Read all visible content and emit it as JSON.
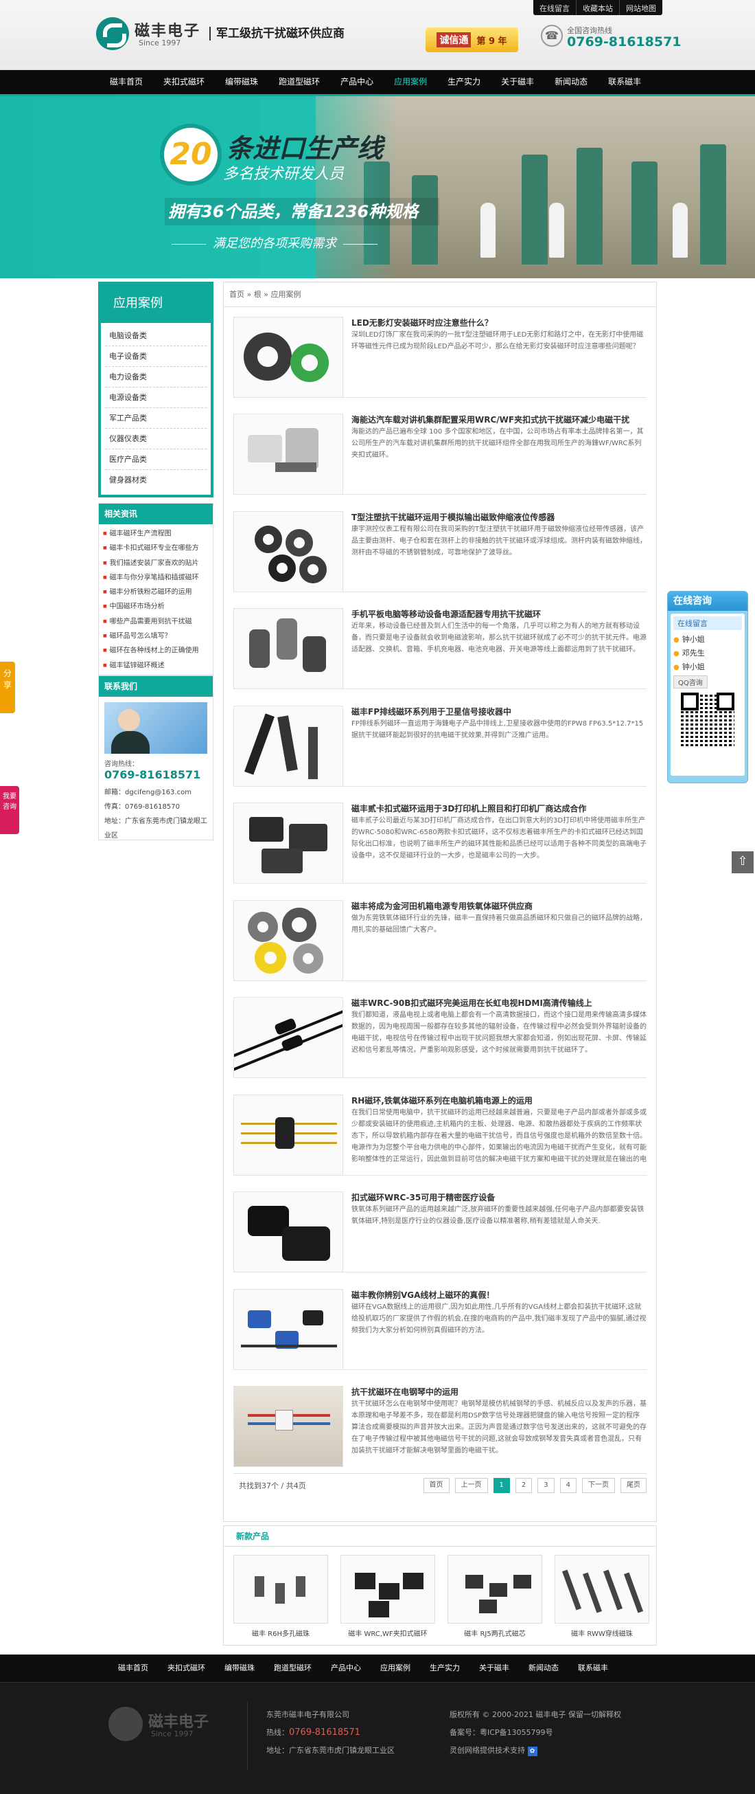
{
  "toplinks": [
    "在线留言",
    "收藏本站",
    "网站地图"
  ],
  "logo": {
    "name": "磁丰电子",
    "since": "Since 1997"
  },
  "slogan": "军工级抗干扰磁环供应商",
  "badge": {
    "tag": "诚信通",
    "years": "第 9 年"
  },
  "hotline": {
    "label": "全国咨询热线",
    "number": "0769-81618571"
  },
  "nav": [
    "磁丰首页",
    "夹扣式磁环",
    "编带磁珠",
    "跑道型磁环",
    "产品中心",
    "应用案例",
    "生产实力",
    "关于磁丰",
    "新闻动态",
    "联系磁丰"
  ],
  "banner": {
    "num": "20",
    "h1": "条进口生产线",
    "h2": "多名技术研发人员",
    "h3": "拥有36个品类，常备1236种规格",
    "h4": "满足您的各项采购需求"
  },
  "sidebar": {
    "title": "应用案例",
    "items": [
      "电脑设备类",
      "电子设备类",
      "电力设备类",
      "电源设备类",
      "军工产品类",
      "仪器仪表类",
      "医疗产品类",
      "健身器材类"
    ]
  },
  "related": {
    "title": "相关资讯",
    "items": [
      "磁丰磁环生产流程图",
      "磁丰卡扣式磁环专业在哪些方",
      "我们描述安装厂家喜欢的贴片",
      "磁丰与你分享笔插和插拔磁环",
      "磁丰分析铁粉芯磁环的运用",
      "中国磁环市场分析",
      "哪些产品需要用到抗干扰磁",
      "磁环品号怎么填写？",
      "磁环在各种线材上的正确使用",
      "磁丰锰锌磁环概述"
    ]
  },
  "contact": {
    "title": "联系我们",
    "hotline_label": "咨询热线：",
    "phone": "0769-81618571",
    "email": "邮箱：dgcifeng@163.com",
    "fax": "传真：0769-81618570",
    "address": "地址：广东省东莞市虎门镇龙眼工业区"
  },
  "breadcrumb": "首页 » 根 » 应用案例",
  "articles": [
    {
      "title": "LED无影灯安装磁环时应注意些什么？",
      "desc": "深圳LED灯饰厂家在我司采购的一批T型注塑磁环用于LED无影灯和路灯之中，在无影灯中使用磁环等磁性元件已成为现阶段LED产品必不可少，那么在给无影灯安装磁环时应注意哪些问题呢？"
    },
    {
      "title": "海能达汽车载对讲机集群配置采用WRC/WF夹扣式抗干扰磁环减少电磁干扰",
      "desc": "海能达的产品已遍布全球 100 多个国家和地区，在中国，公司市场占有率本土品牌排名第一，其公司所生产的汽车载对讲机集群所用的抗干扰磁环组件全部在用我司所生产的海鋒WF/WRC系列夹扣式磁环。"
    },
    {
      "title": "T型注塑抗干扰磁环运用于模拟输出磁致伸缩液位传感器",
      "desc": "康宇测控仪表工程有限公司在我司采购的T型注塑抗干扰磁环用于磁致伸缩液位经带传感器，该产品主要由测杆、电子仓和套在测杆上的非接触的抗干扰磁环或浮球组成。测杆内装有磁致伸缩线，测杆由不导磁的不锈钢管制成，可靠地保护了波导丝。"
    },
    {
      "title": "手机平板电脑等移动设备电源适配器专用抗干扰磁环",
      "desc": "近年来，移动设备已经普及到人们生活中的每一个角落，几乎可以称之为有人的地方就有移动设备，而只要是电子设备就会收到电磁波影响，那么抗干扰磁环就成了必不可少的抗干扰元件。电源适配器、交换机、音箱、手机充电器、电池充电器、开关电源等线上面都运用到了抗干扰磁环。"
    },
    {
      "title": "磁丰FP排线磁环系列用于卫星信号接收器中",
      "desc": "FP排线系列磁环一直运用于海鋒电子产品中排线上,卫星接收器中使用的FPW8 FP63.5*12.7*15据抗干扰磁环能起到很好的抗电磁干扰效果,并得到广泛推广运用。"
    },
    {
      "title": "磁丰贰卡扣式磁环运用于3D打印机上照目和打印机厂商达成合作",
      "desc": "磁丰贰子公司最近与某3D打印机厂商达成合作，在出口到意大利的3D打印机中将使用磁丰所生产的WRC-5080和WRC-6580两款卡扣式磁环，这不仅标志着磁丰所生产的卡扣式磁环已经达到国际化出口标准，也说明了磁丰所生产的磁环其性能和品质已经可以适用于各种不同类型的高端电子设备中，这不仅是磁环行业的一大步，也是磁丰公司的一大步。"
    },
    {
      "title": "磁丰将成为金河田机箱电源专用铁氧体磁环供应商",
      "desc": "做为东莞铁氧体磁环行业的先锋，磁丰一直保持着只做高品质磁环和只做自己的磁环品牌的战略，用扎实的基础回馈广大客户。"
    },
    {
      "title": "磁丰WRC-90B扣式磁环完美运用在长虹电视HDMI高清传输线上",
      "desc": "我们都知道，液晶电视上或者电脑上都会有一个高清数据接口，而这个接口是用来传输高清多媒体数据的，因为电视周围一般都存在较多其他的辐射设备，在传输过程中必然会受到外界辐射设备的电磁干扰，电视信号在传输过程中出现干扰问题我想大家都会知道，例如出现花屏、卡屏、传输延迟和信号紊乱等情况，严重影响观影感受，这个时候就需要用到抗干扰磁环了。"
    },
    {
      "title": "RH磁环,铁氧体磁环系列在电脑机箱电源上的运用",
      "desc": "在我们日常使用电脑中，抗干扰磁环的运用已经越来越普遍，只要是电子产品内部或者外部或多或少都或安装磁环的使用痕迹,主机箱内的主板、处理器、电源、和散热器都处于疾病的工作频率状态下，所以导致机箱内部存在着大量的电磁干扰信号，而且信号强度也是机箱外的数倍至数十倍。电源作为为您整个平台电力供电的中心部件，如果输出的电流因为电磁干扰而产生变化，就有可能影响整体性的正常运行，因此做到目前可信的解决电磁干扰方案和电磁干扰的处理就是在输出的电线上套上抗干扰磁环。"
    },
    {
      "title": "扣式磁环WRC-35可用于精密医疗设备",
      "desc": "铁氧体系列磁环产品的运用越来越广泛,放弃磁环的重要性越来越强,任何电子产品内部都要安装铁氧体磁环,特别是医疗行业的仪器设备,医疗设备以精准著称,稍有差错就是人命关天."
    },
    {
      "title": "磁丰教你辨别VGA线材上磁环的真假！",
      "desc": "磁环在VGA数据线上的运用很广,因为如此用性,几乎所有的VGA线材上都会扣装抗干扰磁环,这就给投机取巧的厂家提供了作假的机会,在搜的电商购的产品中,我们磁丰发现了产品中的猫腻,通过视频我们为大家分析如何辨别真假磁环的方法。"
    },
    {
      "title": "抗干扰磁环在电钢琴中的运用",
      "desc": "抗干扰磁环怎么在电钢琴中使用呢？电钢琴是模仿机械钢琴的手感、机械反应以及发声的乐器，基本原理和电子琴差不多，现在都是利用DSP数字信号处理器把键盘的输入电信号按照一定的程序算法合成需要模拟的声音并放大出来。正因为声音是通过数字信号发送出来的，这就不可避免的存在了电子传输过程中被其他电磁信号干扰的问题,这就会导致成钢琴发音失真或者音色混乱，只有加装抗干扰磁环才能解决电钢琴里面的电磁干扰。"
    }
  ],
  "pager": {
    "info": "共找到37个 / 共4页",
    "first": "首页",
    "prev": "上一页",
    "pages": [
      "1",
      "2",
      "3",
      "4"
    ],
    "next": "下一页",
    "last": "尾页"
  },
  "newprod": {
    "title": "新款产品",
    "items": [
      "磁丰 R6H多孔磁珠",
      "磁丰 WRC,WF夹扣式磁环",
      "磁丰 RJ5两孔式磁芯",
      "磁丰 RWW穿线磁珠"
    ]
  },
  "footer_nav": [
    "磁丰首页",
    "夹扣式磁环",
    "编带磁珠",
    "跑道型磁环",
    "产品中心",
    "应用案例",
    "生产实力",
    "关于磁丰",
    "新闻动态",
    "联系磁丰"
  ],
  "footer": {
    "company": "东莞市磁丰电子有限公司",
    "phone_label": "热线：",
    "phone": "0769-81618571",
    "address": "地址：广东省东莞市虎门镇龙眼工业区",
    "copyright": "版权所有 © 2000-2021 磁丰电子 保留一切解释权",
    "icp": "备案号：粤ICP备13055799号",
    "support": "灵创网络提供技术支持"
  },
  "float": {
    "share": "分享",
    "ask": "我要咨询",
    "qq_title": "在线咨询",
    "qq_tab": "在线留言",
    "agents": [
      "钟小姐",
      "邓先生",
      "钟小姐"
    ],
    "qq_button": "QQ咨询"
  },
  "colors": {
    "accent": "#0fa89b",
    "nav_bg": "#0b0b0b",
    "phone": "#0c8e84"
  }
}
